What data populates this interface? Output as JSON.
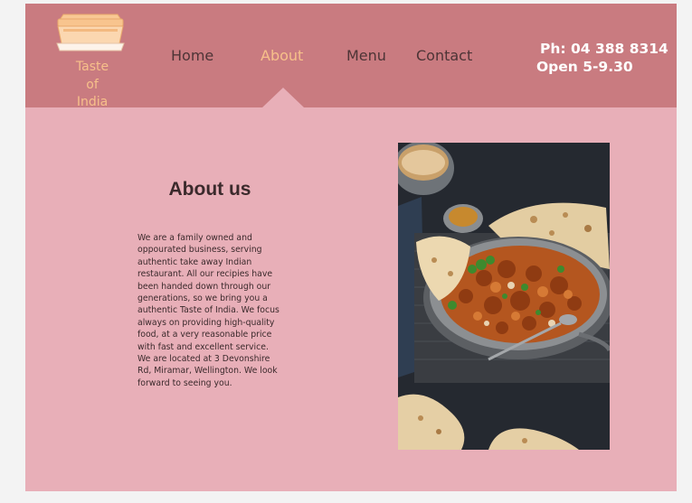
{
  "logo": {
    "line1": "Taste",
    "line2": "of",
    "line3": "India",
    "icon": "takeaway-container-icon",
    "color": "#f7c08a"
  },
  "nav": {
    "items": [
      {
        "label": "Home",
        "active": false
      },
      {
        "label": "About",
        "active": true
      },
      {
        "label": "Menu",
        "active": false
      },
      {
        "label": "Contact",
        "active": false
      }
    ]
  },
  "contact": {
    "phone": "Ph: 04 388 8314",
    "hours": "Open 5-9.30"
  },
  "about": {
    "heading": "About us",
    "body": "We are a family owned and oppourated business, serving authentic take away Indian restaurant. All our recipies have been handed down through our generations, so we bring you a authentic Taste of India. We focus always on providing high-quality food, at a very reasonable price with fast and excellent service. We are located at 3 Devonshire Rd, Miramar, Wellington. We look forward to seeing you."
  },
  "photo": {
    "icon": "curry-dish-photo"
  },
  "colors": {
    "header_bg": "#c97b80",
    "page_bg": "#e8afb8",
    "active_nav": "#f7c08a",
    "nav_text": "#4d3436",
    "outer_bg": "#f3f3f3"
  }
}
